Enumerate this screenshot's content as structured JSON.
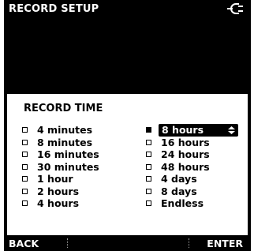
{
  "header": {
    "title": "RECORD SETUP",
    "power_icon": "mains-plug-icon"
  },
  "record_time": {
    "title": "RECORD TIME",
    "left_options": [
      "4 minutes",
      "8 minutes",
      "16 minutes",
      "30 minutes",
      "1 hour",
      "2 hours",
      "4 hours"
    ],
    "right_options": [
      "8 hours",
      "16 hours",
      "24 hours",
      "48 hours",
      "4 days",
      "8 days",
      "Endless"
    ],
    "selected": "8 hours"
  },
  "softkeys": {
    "back": "BACK",
    "enter": "ENTER"
  },
  "colors": {
    "background": "#000000",
    "panel": "#ffffff",
    "text_light": "#ffffff",
    "text_dark": "#000000"
  }
}
